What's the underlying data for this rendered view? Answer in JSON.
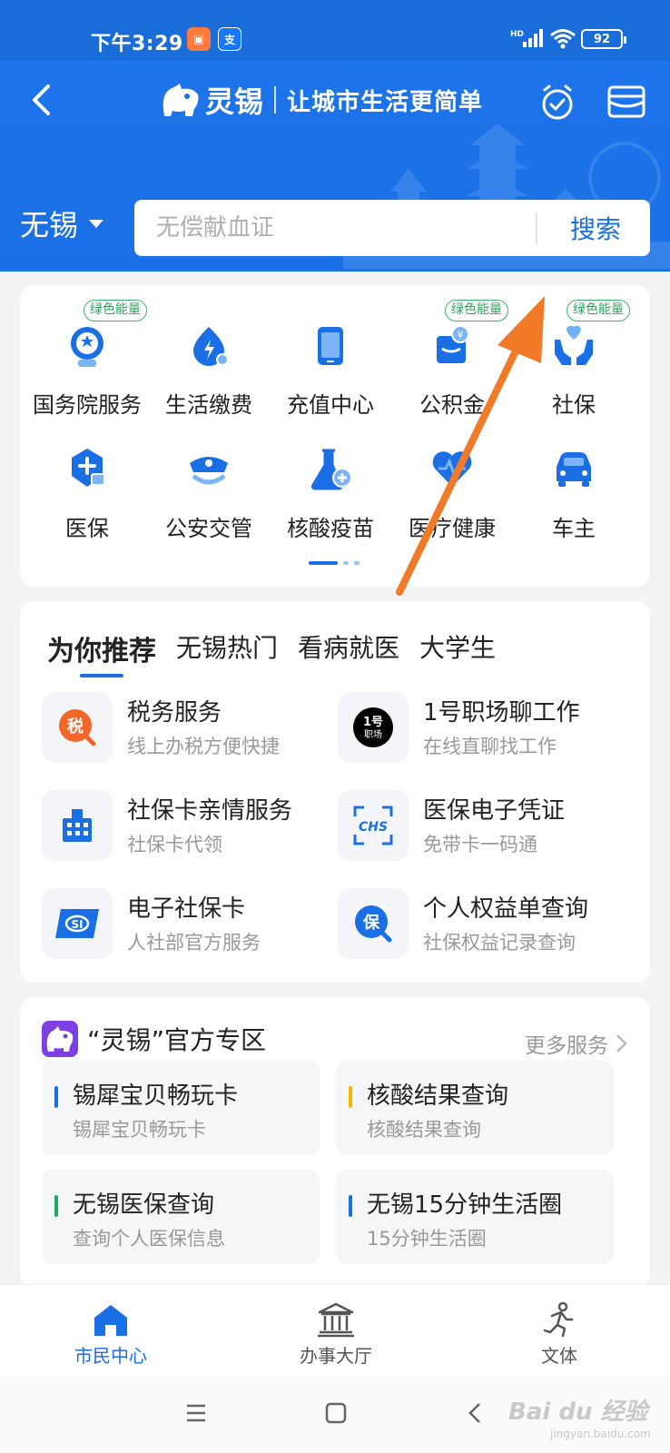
{
  "status_bar": {
    "time": "下午3:29",
    "network": "HD",
    "battery": "92"
  },
  "header": {
    "brand": "灵锡",
    "slogan": "让城市生活更简单",
    "city": "无锡",
    "search_placeholder": "无偿献血证",
    "search_button": "搜索",
    "accent_color": "#1a6fe5"
  },
  "services": {
    "badge_label": "绿色能量",
    "items": [
      {
        "label": "国务院服务",
        "icon": "state-council-icon",
        "badge": true
      },
      {
        "label": "生活缴费",
        "icon": "bill-payment-icon",
        "badge": false
      },
      {
        "label": "充值中心",
        "icon": "phone-recharge-icon",
        "badge": false
      },
      {
        "label": "公积金",
        "icon": "housing-fund-icon",
        "badge": true
      },
      {
        "label": "社保",
        "icon": "social-security-icon",
        "badge": true
      },
      {
        "label": "医保",
        "icon": "medical-insurance-icon",
        "badge": false
      },
      {
        "label": "公安交管",
        "icon": "police-traffic-icon",
        "badge": false
      },
      {
        "label": "核酸疫苗",
        "icon": "test-tube-icon",
        "badge": false
      },
      {
        "label": "医疗健康",
        "icon": "health-heart-icon",
        "badge": false
      },
      {
        "label": "车主",
        "icon": "car-icon",
        "badge": false
      }
    ]
  },
  "recommend": {
    "tabs": [
      "为你推荐",
      "无锡热门",
      "看病就医",
      "大学生"
    ],
    "items": [
      {
        "title": "税务服务",
        "subtitle": "线上办税方便快捷",
        "icon": "tax-icon"
      },
      {
        "title": "1号职场聊工作",
        "subtitle": "在线直聊找工作",
        "icon": "job-icon",
        "icon_text": "1号 职场"
      },
      {
        "title": "社保卡亲情服务",
        "subtitle": "社保卡代领",
        "icon": "building-icon"
      },
      {
        "title": "医保电子凭证",
        "subtitle": "免带卡一码通",
        "icon": "chs-icon",
        "icon_text": "CHS"
      },
      {
        "title": "电子社保卡",
        "subtitle": "人社部官方服务",
        "icon": "si-card-icon",
        "icon_text": "SI"
      },
      {
        "title": "个人权益单查询",
        "subtitle": "社保权益记录查询",
        "icon": "bao-search-icon",
        "icon_text": "保"
      }
    ]
  },
  "official_zone": {
    "title": "“灵锡”官方专区",
    "more": "更多服务",
    "items": [
      {
        "title": "锡犀宝贝畅玩卡",
        "subtitle": "锡犀宝贝畅玩卡",
        "color": "#1a6fe5"
      },
      {
        "title": "核酸结果查询",
        "subtitle": "核酸结果查询",
        "color": "#f5b400"
      },
      {
        "title": "无锡医保查询",
        "subtitle": "查询个人医保信息",
        "color": "#26a862"
      },
      {
        "title": "无锡15分钟生活圈",
        "subtitle": "15分钟生活圈",
        "color": "#1a6fe5"
      }
    ]
  },
  "bottom_nav": {
    "items": [
      {
        "label": "市民中心",
        "active": true
      },
      {
        "label": "办事大厅",
        "active": false
      },
      {
        "label": "文体",
        "active": false
      }
    ]
  },
  "watermark": {
    "text": "Bai du 经验",
    "sub": "jingyan.baidu.com"
  }
}
